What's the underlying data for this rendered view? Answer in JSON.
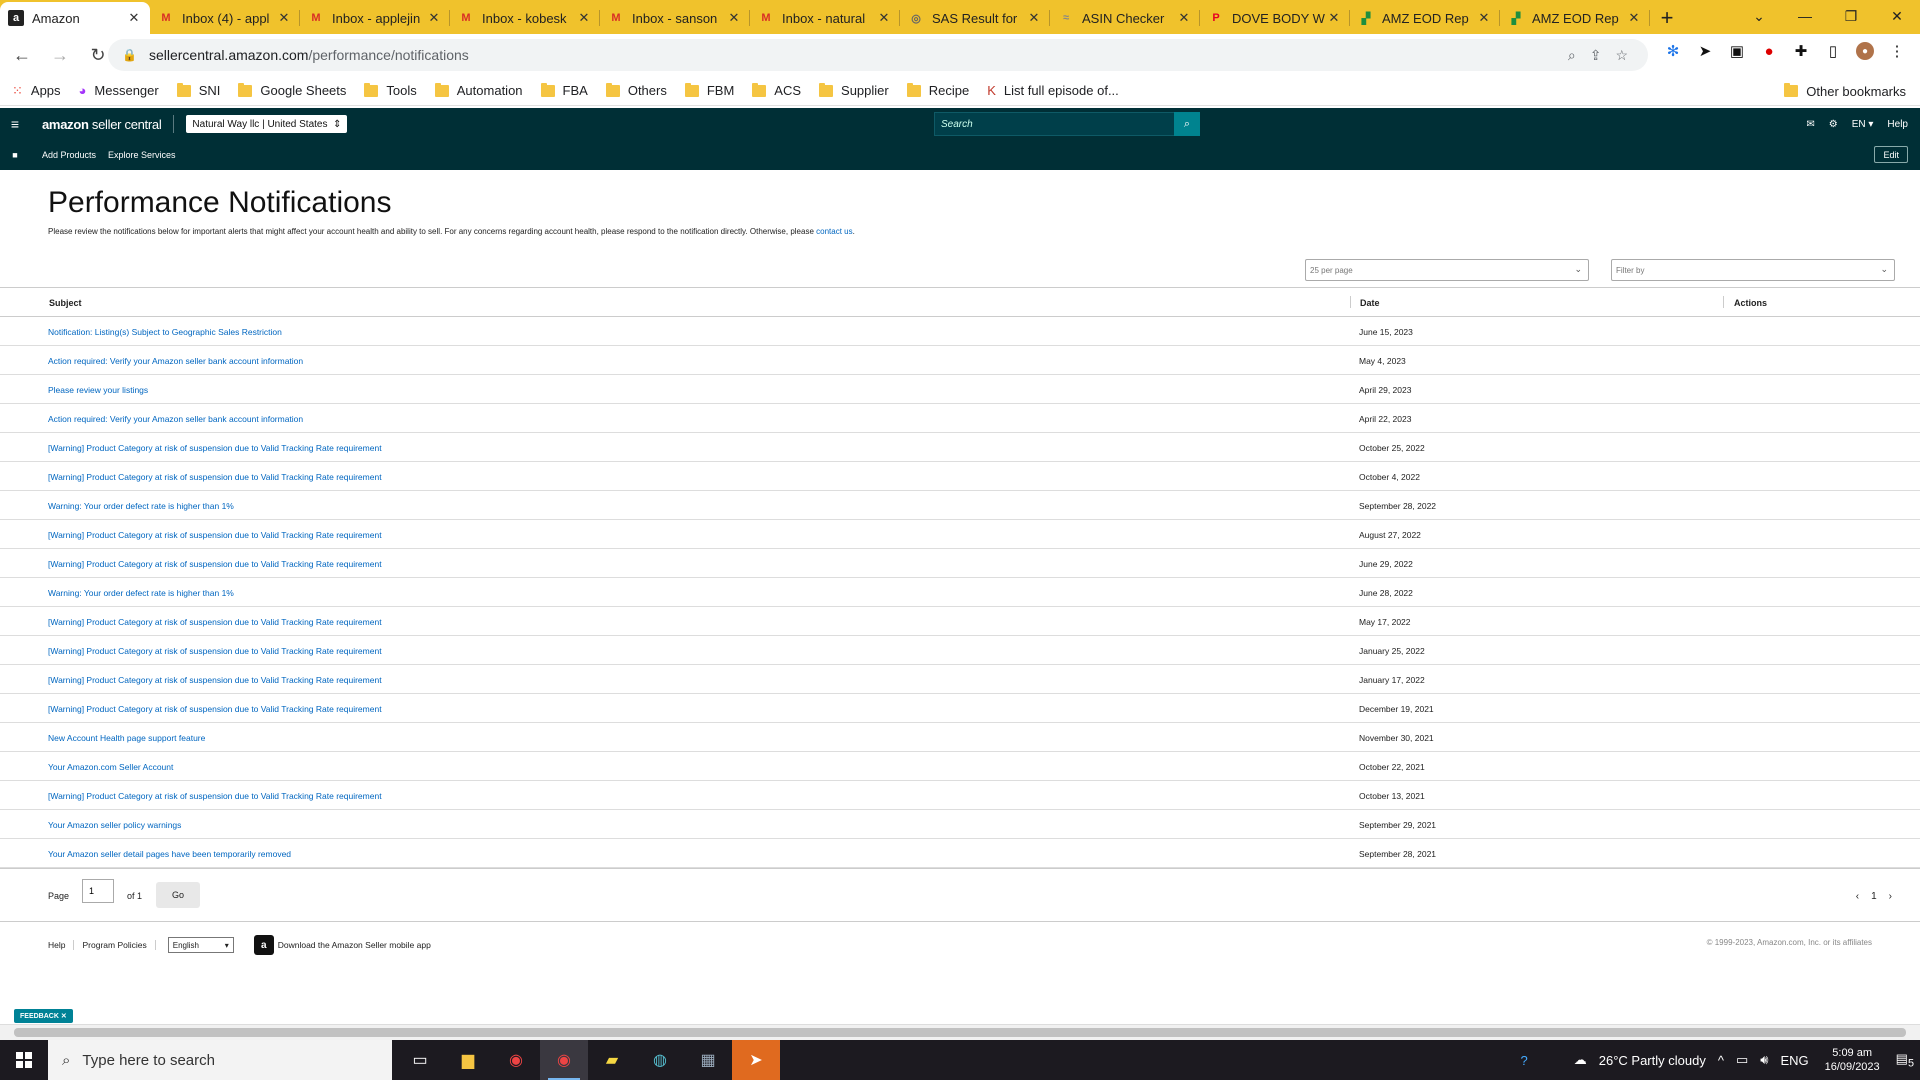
{
  "browser": {
    "tabs": [
      {
        "title": "Amazon",
        "icon": "amazon-icon",
        "active": true
      },
      {
        "title": "Inbox (4) - appl",
        "icon": "gmail-icon"
      },
      {
        "title": "Inbox - applejin",
        "icon": "gmail-icon"
      },
      {
        "title": "Inbox - kobesk",
        "icon": "gmail-icon"
      },
      {
        "title": "Inbox - sanson",
        "icon": "gmail-icon"
      },
      {
        "title": "Inbox - natural",
        "icon": "gmail-icon"
      },
      {
        "title": "SAS Result for",
        "icon": "sas-icon"
      },
      {
        "title": "ASIN Checker",
        "icon": "asin-icon"
      },
      {
        "title": "DOVE BODY W",
        "icon": "pinterest-icon"
      },
      {
        "title": "AMZ EOD Rep",
        "icon": "sheets-icon"
      },
      {
        "title": "AMZ EOD Rep",
        "icon": "sheets-icon"
      }
    ],
    "url_host": "sellercentral.amazon.com",
    "url_path": "/performance/notifications",
    "bookmarks": [
      {
        "label": "Apps",
        "icon": "apps-grid-icon"
      },
      {
        "label": "Messenger",
        "icon": "messenger-icon"
      },
      {
        "label": "SNI",
        "icon": "folder-icon"
      },
      {
        "label": "Google Sheets",
        "icon": "folder-icon"
      },
      {
        "label": "Tools",
        "icon": "folder-icon"
      },
      {
        "label": "Automation",
        "icon": "folder-icon"
      },
      {
        "label": "FBA",
        "icon": "folder-icon"
      },
      {
        "label": "Others",
        "icon": "folder-icon"
      },
      {
        "label": "FBM",
        "icon": "folder-icon"
      },
      {
        "label": "ACS",
        "icon": "folder-icon"
      },
      {
        "label": "Supplier",
        "icon": "folder-icon"
      },
      {
        "label": "Recipe",
        "icon": "folder-icon"
      },
      {
        "label": "List full episode of...",
        "icon": "k-icon"
      }
    ],
    "other_bookmarks": "Other bookmarks"
  },
  "seller_central": {
    "logo_main": "amazon",
    "logo_sub": " seller central",
    "store": "Natural Way llc | United States",
    "search_placeholder": "Search",
    "lang": "EN",
    "help": "Help",
    "subnav": [
      "Add Products",
      "Explore Services"
    ],
    "edit": "Edit"
  },
  "page": {
    "title": "Performance Notifications",
    "description": "Please review the notifications below for important alerts that might affect your account health and ability to sell. For any concerns regarding account health, please respond to the notification directly. Otherwise, please ",
    "contact_link": "contact us",
    "description_end": ".",
    "per_page": "25 per page",
    "filter_placeholder": "Filter by",
    "columns": {
      "subject": "Subject",
      "date": "Date",
      "actions": "Actions"
    },
    "rows": [
      {
        "subject": "Notification: Listing(s) Subject to Geographic Sales Restriction",
        "date": "June 15, 2023"
      },
      {
        "subject": "Action required: Verify your Amazon seller bank account information",
        "date": "May 4, 2023"
      },
      {
        "subject": "Please review your listings",
        "date": "April 29, 2023"
      },
      {
        "subject": "Action required: Verify your Amazon seller bank account information",
        "date": "April 22, 2023"
      },
      {
        "subject": "[Warning] Product Category at risk of suspension due to Valid Tracking Rate requirement",
        "date": "October 25, 2022"
      },
      {
        "subject": "[Warning] Product Category at risk of suspension due to Valid Tracking Rate requirement",
        "date": "October 4, 2022"
      },
      {
        "subject": "Warning: Your order defect rate is higher than 1%",
        "date": "September 28, 2022"
      },
      {
        "subject": "[Warning] Product Category at risk of suspension due to Valid Tracking Rate requirement",
        "date": "August 27, 2022"
      },
      {
        "subject": "[Warning] Product Category at risk of suspension due to Valid Tracking Rate requirement",
        "date": "June 29, 2022"
      },
      {
        "subject": "Warning: Your order defect rate is higher than 1%",
        "date": "June 28, 2022"
      },
      {
        "subject": "[Warning] Product Category at risk of suspension due to Valid Tracking Rate requirement",
        "date": "May 17, 2022"
      },
      {
        "subject": "[Warning] Product Category at risk of suspension due to Valid Tracking Rate requirement",
        "date": "January 25, 2022"
      },
      {
        "subject": "[Warning] Product Category at risk of suspension due to Valid Tracking Rate requirement",
        "date": "January 17, 2022"
      },
      {
        "subject": "[Warning] Product Category at risk of suspension due to Valid Tracking Rate requirement",
        "date": "December 19, 2021"
      },
      {
        "subject": "New Account Health page support feature",
        "date": "November 30, 2021"
      },
      {
        "subject": "Your Amazon.com Seller Account",
        "date": "October 22, 2021"
      },
      {
        "subject": "[Warning] Product Category at risk of suspension due to Valid Tracking Rate requirement",
        "date": "October 13, 2021"
      },
      {
        "subject": "Your Amazon seller policy warnings",
        "date": "September 29, 2021"
      },
      {
        "subject": "Your Amazon seller detail pages have been temporarily removed",
        "date": "September 28, 2021"
      }
    ],
    "pagination": {
      "page_label": "Page",
      "page_value": "1",
      "of_label": "of 1",
      "go": "Go",
      "current": "1"
    }
  },
  "footer": {
    "links": [
      "Help",
      "Program Policies"
    ],
    "language": "English",
    "app_text": "Download the Amazon Seller mobile app",
    "copyright": "© 1999-2023, Amazon.com, Inc. or its affiliates",
    "feedback": "FEEDBACK"
  },
  "taskbar": {
    "search_placeholder": "Type here to search",
    "weather": "26°C  Partly cloudy",
    "lang": "ENG",
    "time": "5:09 am",
    "date": "16/09/2023",
    "notifications": "5"
  }
}
